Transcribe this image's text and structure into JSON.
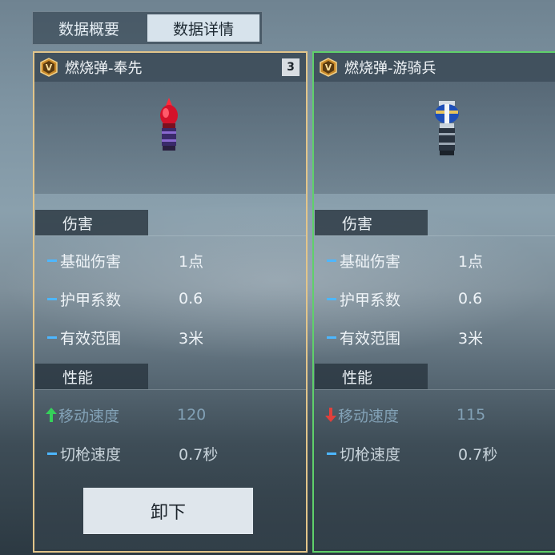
{
  "tabs": [
    {
      "label": "数据概要",
      "active": false
    },
    {
      "label": "数据详情",
      "active": true
    }
  ],
  "colors": {
    "equipped_border": "#e2c58a",
    "compare_border": "#5fd06a",
    "stat_dash": "#4db7ff",
    "up_arrow": "#35d15a",
    "down_arrow": "#e0403c"
  },
  "left_card": {
    "title": "燃烧弹-奉先",
    "count": "3",
    "icon": "grade-v-icon",
    "item_image": "red-incendiary-grenade",
    "sections": {
      "damage": "伤害",
      "performance": "性能"
    },
    "stats": [
      {
        "name": "基础伤害",
        "value": "1点",
        "indicator": "dash"
      },
      {
        "name": "护甲系数",
        "value": "0.6",
        "indicator": "dash"
      },
      {
        "name": "有效范围",
        "value": "3米",
        "indicator": "dash"
      },
      {
        "name": "移动速度",
        "value": "120",
        "indicator": "up-arrow"
      },
      {
        "name": "切枪速度",
        "value": "0.7秒",
        "indicator": "dash"
      }
    ],
    "action_button": "卸下"
  },
  "right_card": {
    "title": "燃烧弹-游骑兵",
    "icon": "grade-v-icon",
    "item_image": "blue-incendiary-grenade",
    "sections": {
      "damage": "伤害",
      "performance": "性能"
    },
    "stats": [
      {
        "name": "基础伤害",
        "value": "1点",
        "indicator": "dash"
      },
      {
        "name": "护甲系数",
        "value": "0.6",
        "indicator": "dash"
      },
      {
        "name": "有效范围",
        "value": "3米",
        "indicator": "dash"
      },
      {
        "name": "移动速度",
        "value": "115",
        "indicator": "down-arrow"
      },
      {
        "name": "切枪速度",
        "value": "0.7秒",
        "indicator": "dash"
      }
    ]
  }
}
